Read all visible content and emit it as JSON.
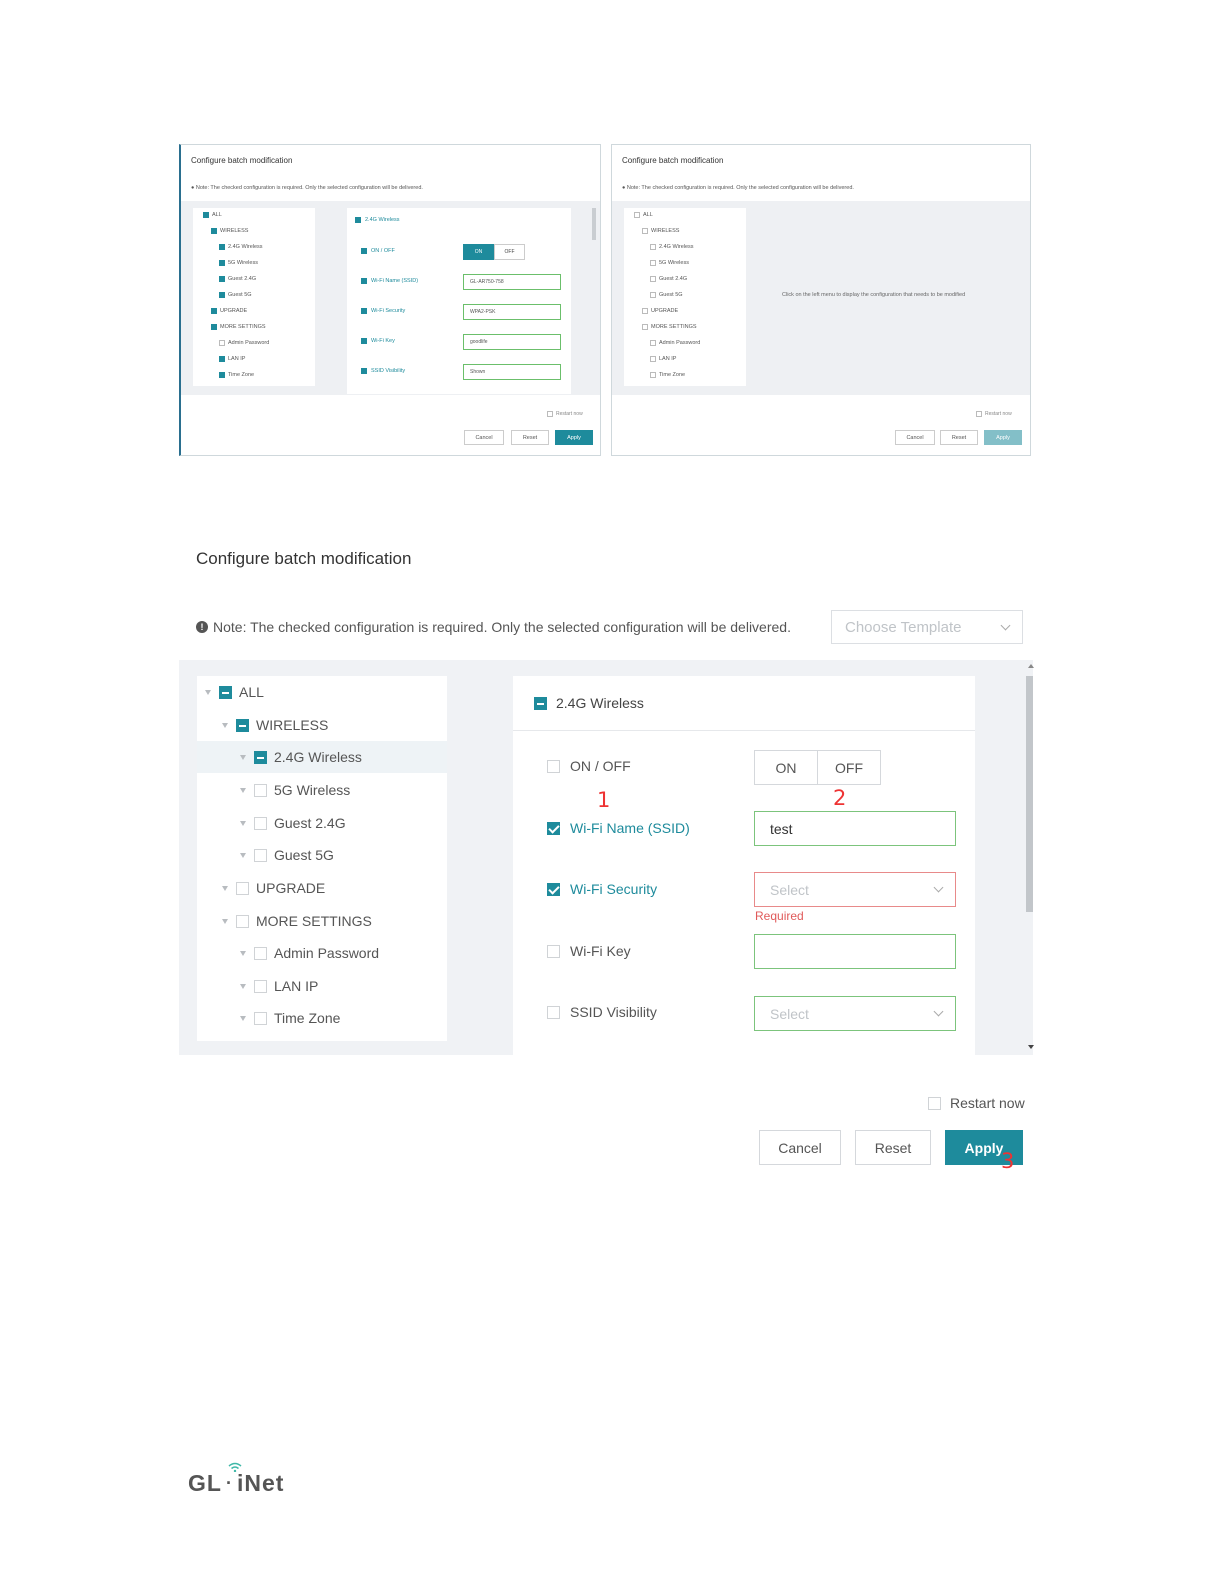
{
  "colors": {
    "accent": "#1e8b9c",
    "required": "#e05a5a",
    "annotation": "#e33333"
  },
  "mini_left": {
    "title": "Configure batch modification",
    "note": "Note: The checked configuration is required. Only the selected configuration will be delivered.",
    "tree": [
      "ALL",
      "WIRELESS",
      "2.4G Wireless",
      "5G Wireless",
      "Guest 2.4G",
      "Guest 5G",
      "UPGRADE",
      "MORE SETTINGS",
      "Admin Password",
      "LAN IP",
      "Time Zone"
    ],
    "panel_title": "2.4G Wireless",
    "fields": [
      "ON / OFF",
      "Wi-Fi Name (SSID)",
      "Wi-Fi Security",
      "Wi-Fi Key",
      "SSID Visibility"
    ],
    "toggle_on": "ON",
    "toggle_off": "OFF",
    "ssid_value": "GL-AR750-758",
    "security_value": "WPA2-PSK",
    "key_value": "goodlife",
    "visibility_value": "Shown",
    "restart": "Restart now",
    "cancel": "Cancel",
    "reset": "Reset",
    "apply": "Apply"
  },
  "mini_right": {
    "title": "Configure batch modification",
    "note": "Note: The checked configuration is required. Only the selected configuration will be delivered.",
    "tree": [
      "ALL",
      "WIRELESS",
      "2.4G Wireless",
      "5G Wireless",
      "Guest 2.4G",
      "Guest 5G",
      "UPGRADE",
      "MORE SETTINGS",
      "Admin Password",
      "LAN IP",
      "Time Zone"
    ],
    "hint": "Click on the left menu to display the configuration that needs to be modified",
    "restart": "Restart now",
    "cancel": "Cancel",
    "reset": "Reset",
    "apply": "Apply"
  },
  "dialog": {
    "title": "Configure batch modification",
    "note": "Note: The checked configuration is required. Only the selected configuration will be delivered.",
    "template_placeholder": "Choose Template",
    "tree": {
      "all": "ALL",
      "wireless": "WIRELESS",
      "w24": "2.4G Wireless",
      "w5": "5G Wireless",
      "guest24": "Guest 2.4G",
      "guest5": "Guest 5G",
      "upgrade": "UPGRADE",
      "more": "MORE SETTINGS",
      "admin": "Admin Password",
      "lanip": "LAN IP",
      "timezone": "Time Zone"
    },
    "panel": {
      "title": "2.4G Wireless",
      "onoff_label": "ON / OFF",
      "on": "ON",
      "off": "OFF",
      "ssid_label": "Wi-Fi Name (SSID)",
      "ssid_value": "test",
      "security_label": "Wi-Fi Security",
      "security_placeholder": "Select",
      "required": "Required",
      "key_label": "Wi-Fi Key",
      "key_value": "",
      "visibility_label": "SSID Visibility",
      "visibility_placeholder": "Select"
    },
    "restart": "Restart now",
    "cancel": "Cancel",
    "reset": "Reset",
    "apply": "Apply"
  },
  "annotations": {
    "a1": "1",
    "a2": "2",
    "a3": "3"
  },
  "logo": {
    "left": "GL",
    "dot": "·",
    "right": "iNet"
  }
}
